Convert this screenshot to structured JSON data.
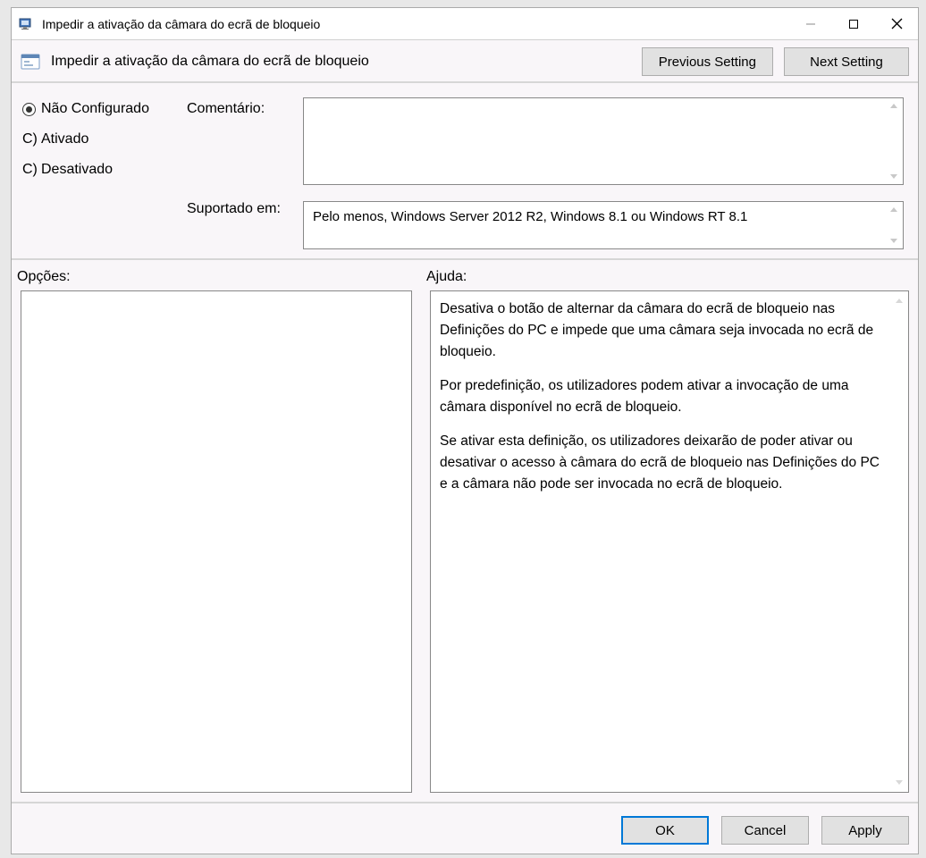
{
  "titlebar": {
    "title": "Impedir a ativação da câmara do ecrã de bloqueio"
  },
  "header": {
    "title": "Impedir a ativação da câmara do ecrã de bloqueio",
    "prev_label": "Previous Setting",
    "next_label": "Next Setting"
  },
  "radios": {
    "not_configured": "Não Configurado",
    "enabled": "Ativado",
    "disabled": "Desativado",
    "selected": "not_configured"
  },
  "labels": {
    "comment": "Comentário:",
    "supported": "Suportado em:",
    "options": "Opções:",
    "help": "Ajuda:"
  },
  "fields": {
    "comment_value": "",
    "supported_value": "Pelo menos, Windows Server 2012 R2, Windows 8.1 ou Windows RT 8.1"
  },
  "help": {
    "p1": "Desativa o botão de alternar da câmara do ecrã de bloqueio nas Definições do PC e impede que uma câmara seja invocada no ecrã de bloqueio.",
    "p2": "Por predefinição, os utilizadores podem ativar a invocação de uma câmara disponível no ecrã de bloqueio.",
    "p3": "Se ativar esta definição, os utilizadores deixarão de poder ativar ou desativar o acesso à câmara do ecrã de bloqueio nas Definições do PC e a câmara não pode ser invocada no ecrã de bloqueio."
  },
  "buttons": {
    "ok": "OK",
    "cancel": "Cancel",
    "apply": "Apply"
  }
}
